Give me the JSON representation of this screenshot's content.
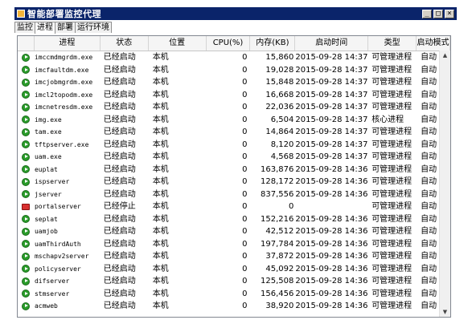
{
  "window": {
    "title": "智能部署监控代理",
    "min_symbol": "_",
    "max_symbol": "□",
    "close_symbol": "×"
  },
  "tabs": [
    {
      "label": "监控",
      "active": false
    },
    {
      "label": "进程",
      "active": true
    },
    {
      "label": "部署",
      "active": false
    },
    {
      "label": "运行环境",
      "active": false
    }
  ],
  "columns": {
    "process": "进程",
    "status": "状态",
    "location": "位置",
    "cpu": "CPU(%)",
    "memory": "内存(KB)",
    "start_time": "启动时间",
    "type": "类型",
    "start_mode": "启动模式"
  },
  "rows": [
    {
      "icon": "running-icon",
      "name": "imccmdmgrdm.exe",
      "status": "已经启动",
      "location": "本机",
      "cpu": "0",
      "mem": "15,860",
      "time": "2015-09-28 14:37:20",
      "type": "可管理进程",
      "mode": "自动"
    },
    {
      "icon": "running-icon",
      "name": "imcfaultdm.exe",
      "status": "已经启动",
      "location": "本机",
      "cpu": "0",
      "mem": "19,028",
      "time": "2015-09-28 14:37:20",
      "type": "可管理进程",
      "mode": "自动"
    },
    {
      "icon": "running-icon",
      "name": "imcjobmgrdm.exe",
      "status": "已经启动",
      "location": "本机",
      "cpu": "0",
      "mem": "15,848",
      "time": "2015-09-28 14:37:20",
      "type": "可管理进程",
      "mode": "自动"
    },
    {
      "icon": "running-icon",
      "name": "imcl2topodm.exe",
      "status": "已经启动",
      "location": "本机",
      "cpu": "0",
      "mem": "16,668",
      "time": "2015-09-28 14:37:20",
      "type": "可管理进程",
      "mode": "自动"
    },
    {
      "icon": "running-icon",
      "name": "imcnetresdm.exe",
      "status": "已经启动",
      "location": "本机",
      "cpu": "0",
      "mem": "22,036",
      "time": "2015-09-28 14:37:20",
      "type": "可管理进程",
      "mode": "自动"
    },
    {
      "icon": "running-icon",
      "name": "img.exe",
      "status": "已经启动",
      "location": "本机",
      "cpu": "0",
      "mem": "6,504",
      "time": "2015-09-28 14:37:15",
      "type": "核心进程",
      "mode": "自动"
    },
    {
      "icon": "running-icon",
      "name": "tam.exe",
      "status": "已经启动",
      "location": "本机",
      "cpu": "0",
      "mem": "14,864",
      "time": "2015-09-28 14:37:21",
      "type": "可管理进程",
      "mode": "自动"
    },
    {
      "icon": "running-icon",
      "name": "tftpserver.exe",
      "status": "已经启动",
      "location": "本机",
      "cpu": "0",
      "mem": "8,120",
      "time": "2015-09-28 14:37:05",
      "type": "可管理进程",
      "mode": "自动"
    },
    {
      "icon": "running-icon",
      "name": "uam.exe",
      "status": "已经启动",
      "location": "本机",
      "cpu": "0",
      "mem": "4,568",
      "time": "2015-09-28 14:37:21",
      "type": "可管理进程",
      "mode": "自动"
    },
    {
      "icon": "running-icon",
      "name": "euplat",
      "status": "已经启动",
      "location": "本机",
      "cpu": "0",
      "mem": "163,876",
      "time": "2015-09-28 14:36:34",
      "type": "可管理进程",
      "mode": "自动"
    },
    {
      "icon": "running-icon",
      "name": "ispserver",
      "status": "已经启动",
      "location": "本机",
      "cpu": "0",
      "mem": "128,172",
      "time": "2015-09-28 14:36:34",
      "type": "可管理进程",
      "mode": "自动"
    },
    {
      "icon": "running-icon",
      "name": "jserver",
      "status": "已经启动",
      "location": "本机",
      "cpu": "0",
      "mem": "837,556",
      "time": "2015-09-28 14:36:34",
      "type": "可管理进程",
      "mode": "自动"
    },
    {
      "icon": "stopped-icon",
      "name": "portalserver",
      "status": "已经停止",
      "location": "本机",
      "cpu": "0",
      "mem": "0",
      "time": "",
      "type": "可管理进程",
      "mode": "自动"
    },
    {
      "icon": "running-icon",
      "name": "seplat",
      "status": "已经启动",
      "location": "本机",
      "cpu": "0",
      "mem": "152,216",
      "time": "2015-09-28 14:36:34",
      "type": "可管理进程",
      "mode": "自动"
    },
    {
      "icon": "running-icon",
      "name": "uamjob",
      "status": "已经启动",
      "location": "本机",
      "cpu": "0",
      "mem": "42,512",
      "time": "2015-09-28 14:36:34",
      "type": "可管理进程",
      "mode": "自动"
    },
    {
      "icon": "running-icon",
      "name": "uamThirdAuth",
      "status": "已经启动",
      "location": "本机",
      "cpu": "0",
      "mem": "197,784",
      "time": "2015-09-28 14:36:34",
      "type": "可管理进程",
      "mode": "自动"
    },
    {
      "icon": "running-icon",
      "name": "mschapv2server",
      "status": "已经启动",
      "location": "本机",
      "cpu": "0",
      "mem": "37,872",
      "time": "2015-09-28 14:36:34",
      "type": "可管理进程",
      "mode": "自动"
    },
    {
      "icon": "running-icon",
      "name": "policyserver",
      "status": "已经启动",
      "location": "本机",
      "cpu": "0",
      "mem": "45,092",
      "time": "2015-09-28 14:36:34",
      "type": "可管理进程",
      "mode": "自动"
    },
    {
      "icon": "running-icon",
      "name": "difserver",
      "status": "已经启动",
      "location": "本机",
      "cpu": "0",
      "mem": "125,508",
      "time": "2015-09-28 14:36:34",
      "type": "可管理进程",
      "mode": "自动"
    },
    {
      "icon": "running-icon",
      "name": "stmserver",
      "status": "已经启动",
      "location": "本机",
      "cpu": "0",
      "mem": "156,456",
      "time": "2015-09-28 14:36:34",
      "type": "可管理进程",
      "mode": "自动"
    },
    {
      "icon": "running-icon",
      "name": "acmweb",
      "status": "已经启动",
      "location": "本机",
      "cpu": "0",
      "mem": "38,920",
      "time": "2015-09-28 14:36:34",
      "type": "可管理进程",
      "mode": "自动"
    }
  ],
  "scrollbar": {
    "up_arrow": "▲",
    "down_arrow": "▼"
  }
}
